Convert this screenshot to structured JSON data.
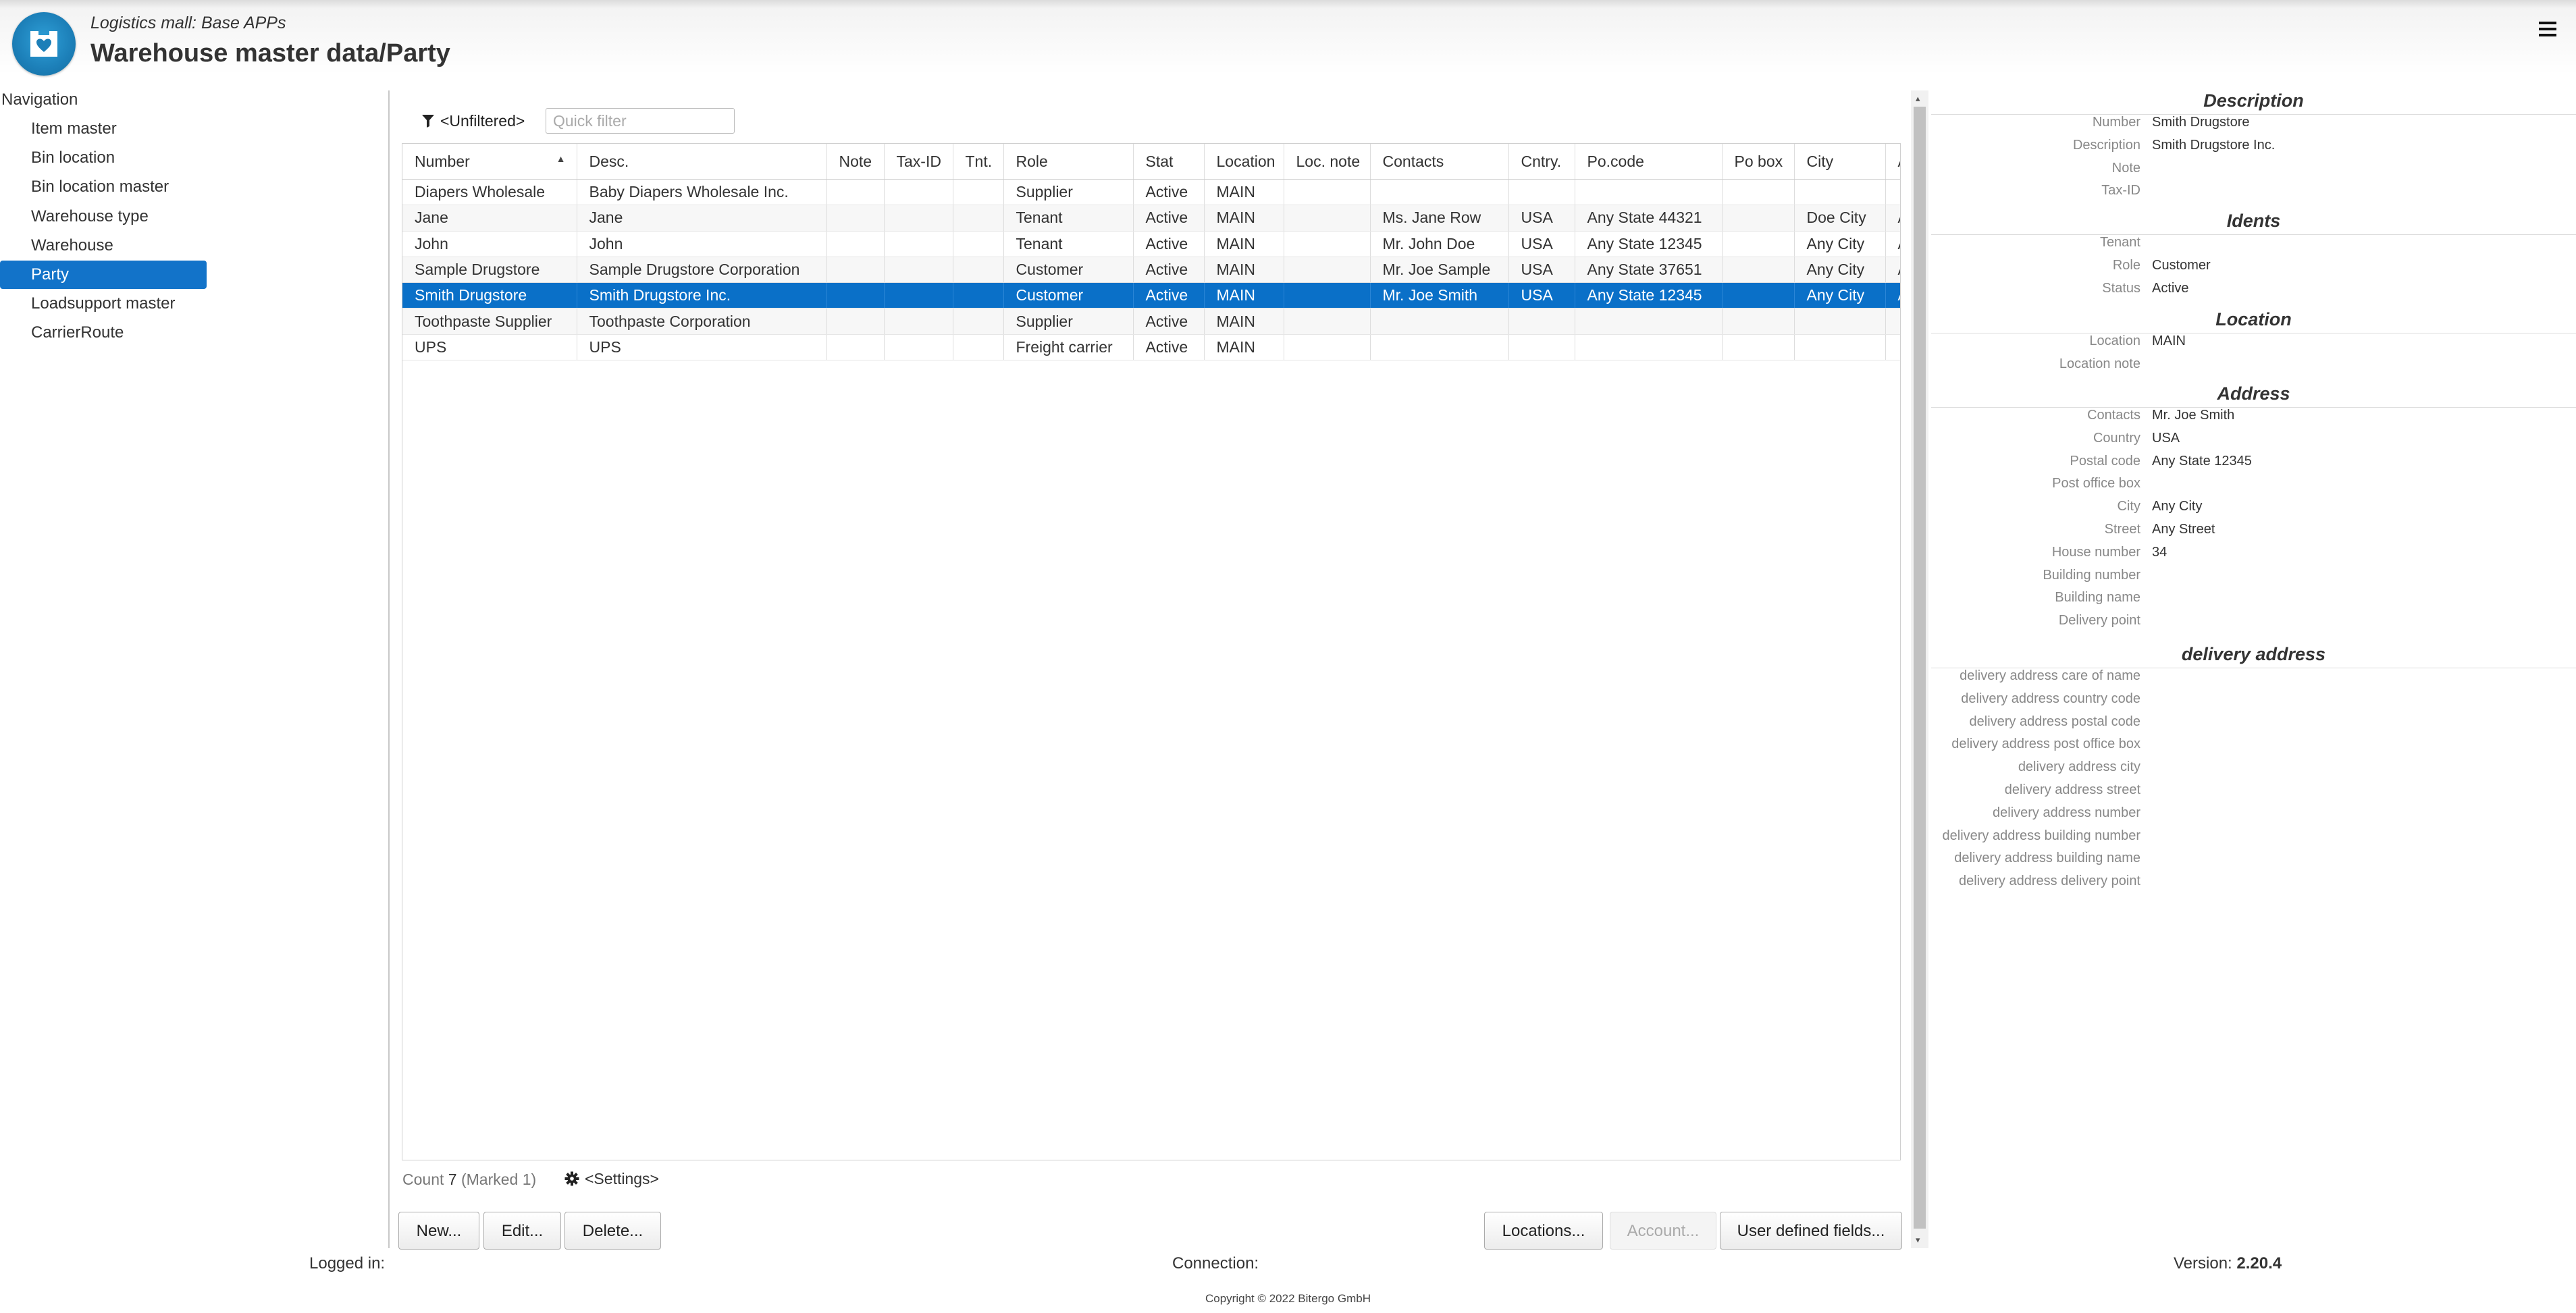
{
  "header": {
    "subtitle": "Logistics mall: Base APPs",
    "title": "Warehouse master data/Party",
    "colors": {
      "brand": "#1c7fb8"
    }
  },
  "navigation": {
    "heading": "Navigation",
    "items": [
      {
        "label": "Item master",
        "active": false
      },
      {
        "label": "Bin location",
        "active": false
      },
      {
        "label": "Bin location master",
        "active": false
      },
      {
        "label": "Warehouse type",
        "active": false
      },
      {
        "label": "Warehouse",
        "active": false
      },
      {
        "label": "Party",
        "active": true
      },
      {
        "label": "Loadsupport master",
        "active": false
      },
      {
        "label": "CarrierRoute",
        "active": false
      }
    ],
    "active_color": "#1273c9"
  },
  "filter": {
    "label": "<Unfiltered>",
    "placeholder": "Quick filter",
    "icon": "filter-icon"
  },
  "grid": {
    "columns": [
      "Number",
      "Desc.",
      "Note",
      "Tax-ID",
      "Tnt.",
      "Role",
      "Stat",
      "Location",
      "Loc. note",
      "Contacts",
      "Cntry.",
      "Po.code",
      "Po box",
      "City",
      "A"
    ],
    "sorted_column": "Number",
    "rows": [
      {
        "cells": [
          "Diapers Wholesale",
          "Baby Diapers Wholesale Inc.",
          "",
          "",
          "",
          "Supplier",
          "Active",
          "MAIN",
          "",
          "",
          "",
          "",
          "",
          "",
          ""
        ],
        "selected": false
      },
      {
        "cells": [
          "Jane",
          "Jane",
          "",
          "",
          "",
          "Tenant",
          "Active",
          "MAIN",
          "",
          "Ms. Jane Row",
          "USA",
          "Any State 44321",
          "",
          "Doe City",
          "A"
        ],
        "selected": false
      },
      {
        "cells": [
          "John",
          "John",
          "",
          "",
          "",
          "Tenant",
          "Active",
          "MAIN",
          "",
          "Mr. John Doe",
          "USA",
          "Any State 12345",
          "",
          "Any City",
          "A"
        ],
        "selected": false
      },
      {
        "cells": [
          "Sample Drugstore",
          "Sample Drugstore Corporation",
          "",
          "",
          "",
          "Customer",
          "Active",
          "MAIN",
          "",
          "Mr. Joe Sample",
          "USA",
          "Any State 37651",
          "",
          "Any City",
          "A"
        ],
        "selected": false
      },
      {
        "cells": [
          "Smith Drugstore",
          "Smith Drugstore Inc.",
          "",
          "",
          "",
          "Customer",
          "Active",
          "MAIN",
          "",
          "Mr. Joe Smith",
          "USA",
          "Any State 12345",
          "",
          "Any City",
          "A"
        ],
        "selected": true
      },
      {
        "cells": [
          "Toothpaste Supplier",
          "Toothpaste Corporation",
          "",
          "",
          "",
          "Supplier",
          "Active",
          "MAIN",
          "",
          "",
          "",
          "",
          "",
          "",
          ""
        ],
        "selected": false
      },
      {
        "cells": [
          "UPS",
          "UPS",
          "",
          "",
          "",
          "Freight carrier",
          "Active",
          "MAIN",
          "",
          "",
          "",
          "",
          "",
          "",
          ""
        ],
        "selected": false
      }
    ],
    "selection_color": "#0a70c8"
  },
  "footer_bar": {
    "count_label": "Count",
    "count": "7",
    "marked_text": "(Marked 1)",
    "settings_label": "<Settings>"
  },
  "buttons": {
    "new": "New...",
    "edit": "Edit...",
    "delete": "Delete...",
    "locations": "Locations...",
    "account": "Account...",
    "user_defined_fields": "User defined fields..."
  },
  "details": {
    "sections": [
      {
        "title": "Description",
        "fields": [
          {
            "label": "Number",
            "value": "Smith Drugstore"
          },
          {
            "label": "Description",
            "value": "Smith Drugstore Inc."
          },
          {
            "label": "Note",
            "value": ""
          },
          {
            "label": "Tax-ID",
            "value": ""
          }
        ]
      },
      {
        "title": "Idents",
        "fields": [
          {
            "label": "Tenant",
            "value": ""
          },
          {
            "label": "Role",
            "value": "Customer"
          },
          {
            "label": "Status",
            "value": "Active"
          }
        ]
      },
      {
        "title": "Location",
        "fields": [
          {
            "label": "Location",
            "value": "MAIN"
          },
          {
            "label": "Location note",
            "value": ""
          }
        ]
      },
      {
        "title": "Address",
        "fields": [
          {
            "label": "Contacts",
            "value": "Mr. Joe Smith"
          },
          {
            "label": "Country",
            "value": "USA"
          },
          {
            "label": "Postal code",
            "value": "Any State 12345"
          },
          {
            "label": "Post office box",
            "value": ""
          },
          {
            "label": "City",
            "value": "Any City"
          },
          {
            "label": "Street",
            "value": "Any Street"
          },
          {
            "label": "House number",
            "value": "34"
          },
          {
            "label": "Building number",
            "value": ""
          },
          {
            "label": "Building name",
            "value": ""
          },
          {
            "label": "Delivery point",
            "value": ""
          }
        ]
      },
      {
        "title": "delivery address",
        "fields": [
          {
            "label": "delivery address care of name",
            "value": ""
          },
          {
            "label": "delivery address country code",
            "value": ""
          },
          {
            "label": "delivery address postal code",
            "value": ""
          },
          {
            "label": "delivery address post office box",
            "value": ""
          },
          {
            "label": "delivery address city",
            "value": ""
          },
          {
            "label": "delivery address street",
            "value": ""
          },
          {
            "label": "delivery address number",
            "value": ""
          },
          {
            "label": "delivery address building number",
            "value": ""
          },
          {
            "label": "delivery address building name",
            "value": ""
          },
          {
            "label": "delivery address delivery point",
            "value": ""
          }
        ]
      }
    ]
  },
  "status": {
    "logged_in_label": "Logged in:",
    "connection_label": "Connection:",
    "version_label": "Version:",
    "version": "2.20.4"
  },
  "copyright": "Copyright © 2022 Bitergo GmbH"
}
